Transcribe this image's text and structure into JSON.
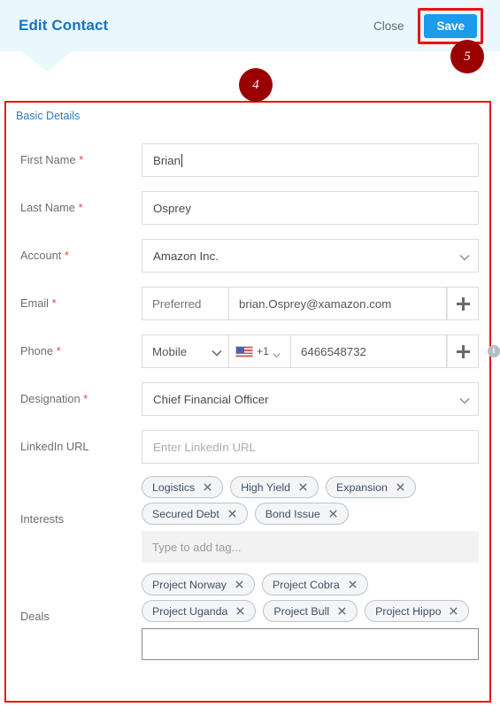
{
  "header": {
    "title": "Edit Contact",
    "close_label": "Close",
    "save_label": "Save",
    "bg_color": "#eaf7fd",
    "title_color": "#1474c4",
    "save_color": "#1b9bea"
  },
  "annotations": {
    "color": "#9b0000",
    "highlight_color": "#ee1111",
    "badges": [
      {
        "number": "4",
        "target": "form-panel"
      },
      {
        "number": "5",
        "target": "save-button"
      }
    ]
  },
  "panel": {
    "section_title": "Basic Details"
  },
  "fields": {
    "first_name": {
      "label": "First Name",
      "required": "*",
      "value": "Brian",
      "placeholder": ""
    },
    "last_name": {
      "label": "Last Name",
      "required": "*",
      "value": "Osprey",
      "placeholder": ""
    },
    "account": {
      "label": "Account",
      "required": "*",
      "value": "Amazon Inc.",
      "icon": "chevron-down-icon"
    },
    "email": {
      "label": "Email",
      "required": "*",
      "preference": "Preferred",
      "value": "brian.Osprey@xamazon.com",
      "add_icon": "plus-icon"
    },
    "phone": {
      "label": "Phone",
      "required": "*",
      "type": "Mobile",
      "country_flag": "us-flag-icon",
      "country_code": "+1",
      "value": "6466548732",
      "add_icon": "plus-icon"
    },
    "designation": {
      "label": "Designation",
      "required": "*",
      "value": "Chief Financial Officer",
      "icon": "chevron-down-icon"
    },
    "linkedin": {
      "label": "LinkedIn URL",
      "required": "",
      "value": "",
      "placeholder": "Enter LinkedIn URL"
    },
    "interests": {
      "label": "Interests",
      "required": "",
      "tag_rows": [
        [
          "Logistics",
          "High Yield",
          "Expansion"
        ],
        [
          "Secured Debt",
          "Bond Issue"
        ]
      ],
      "input_placeholder": "Type to add tag...",
      "input_value": ""
    },
    "deals": {
      "label": "Deals",
      "required": "",
      "tag_rows": [
        [
          "Project Norway",
          "Project Cobra"
        ],
        [
          "Project Uganda",
          "Project Bull",
          "Project Hippo"
        ]
      ],
      "input_placeholder": "",
      "input_value": ""
    }
  },
  "info_icon": {
    "name": "info-icon",
    "glyph": "i"
  }
}
